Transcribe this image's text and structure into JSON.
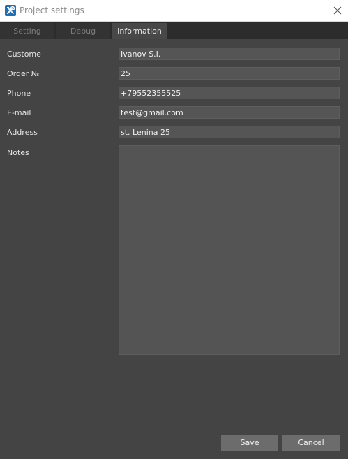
{
  "window": {
    "title": "Project settings"
  },
  "tabs": [
    {
      "label": "Setting",
      "active": false
    },
    {
      "label": "Debug",
      "active": false
    },
    {
      "label": "Information",
      "active": true
    }
  ],
  "form": {
    "customer": {
      "label": "Custome",
      "value": "Ivanov S.I."
    },
    "order": {
      "label": "Order №",
      "value": "25"
    },
    "phone": {
      "label": "Phone",
      "value": "+79552355525"
    },
    "email": {
      "label": "E-mail",
      "value": "test@gmail.com"
    },
    "address": {
      "label": "Address",
      "value": "st. Lenina 25"
    },
    "notes": {
      "label": "Notes",
      "value": ""
    }
  },
  "buttons": {
    "save": "Save",
    "cancel": "Cancel"
  },
  "icons": {
    "app": "tools-icon",
    "close": "close-icon"
  },
  "colors": {
    "background": "#444444",
    "tab_active": "#484848",
    "input": "#555555",
    "button": "#6c6c6c",
    "app_icon": "#1f6fb5"
  }
}
